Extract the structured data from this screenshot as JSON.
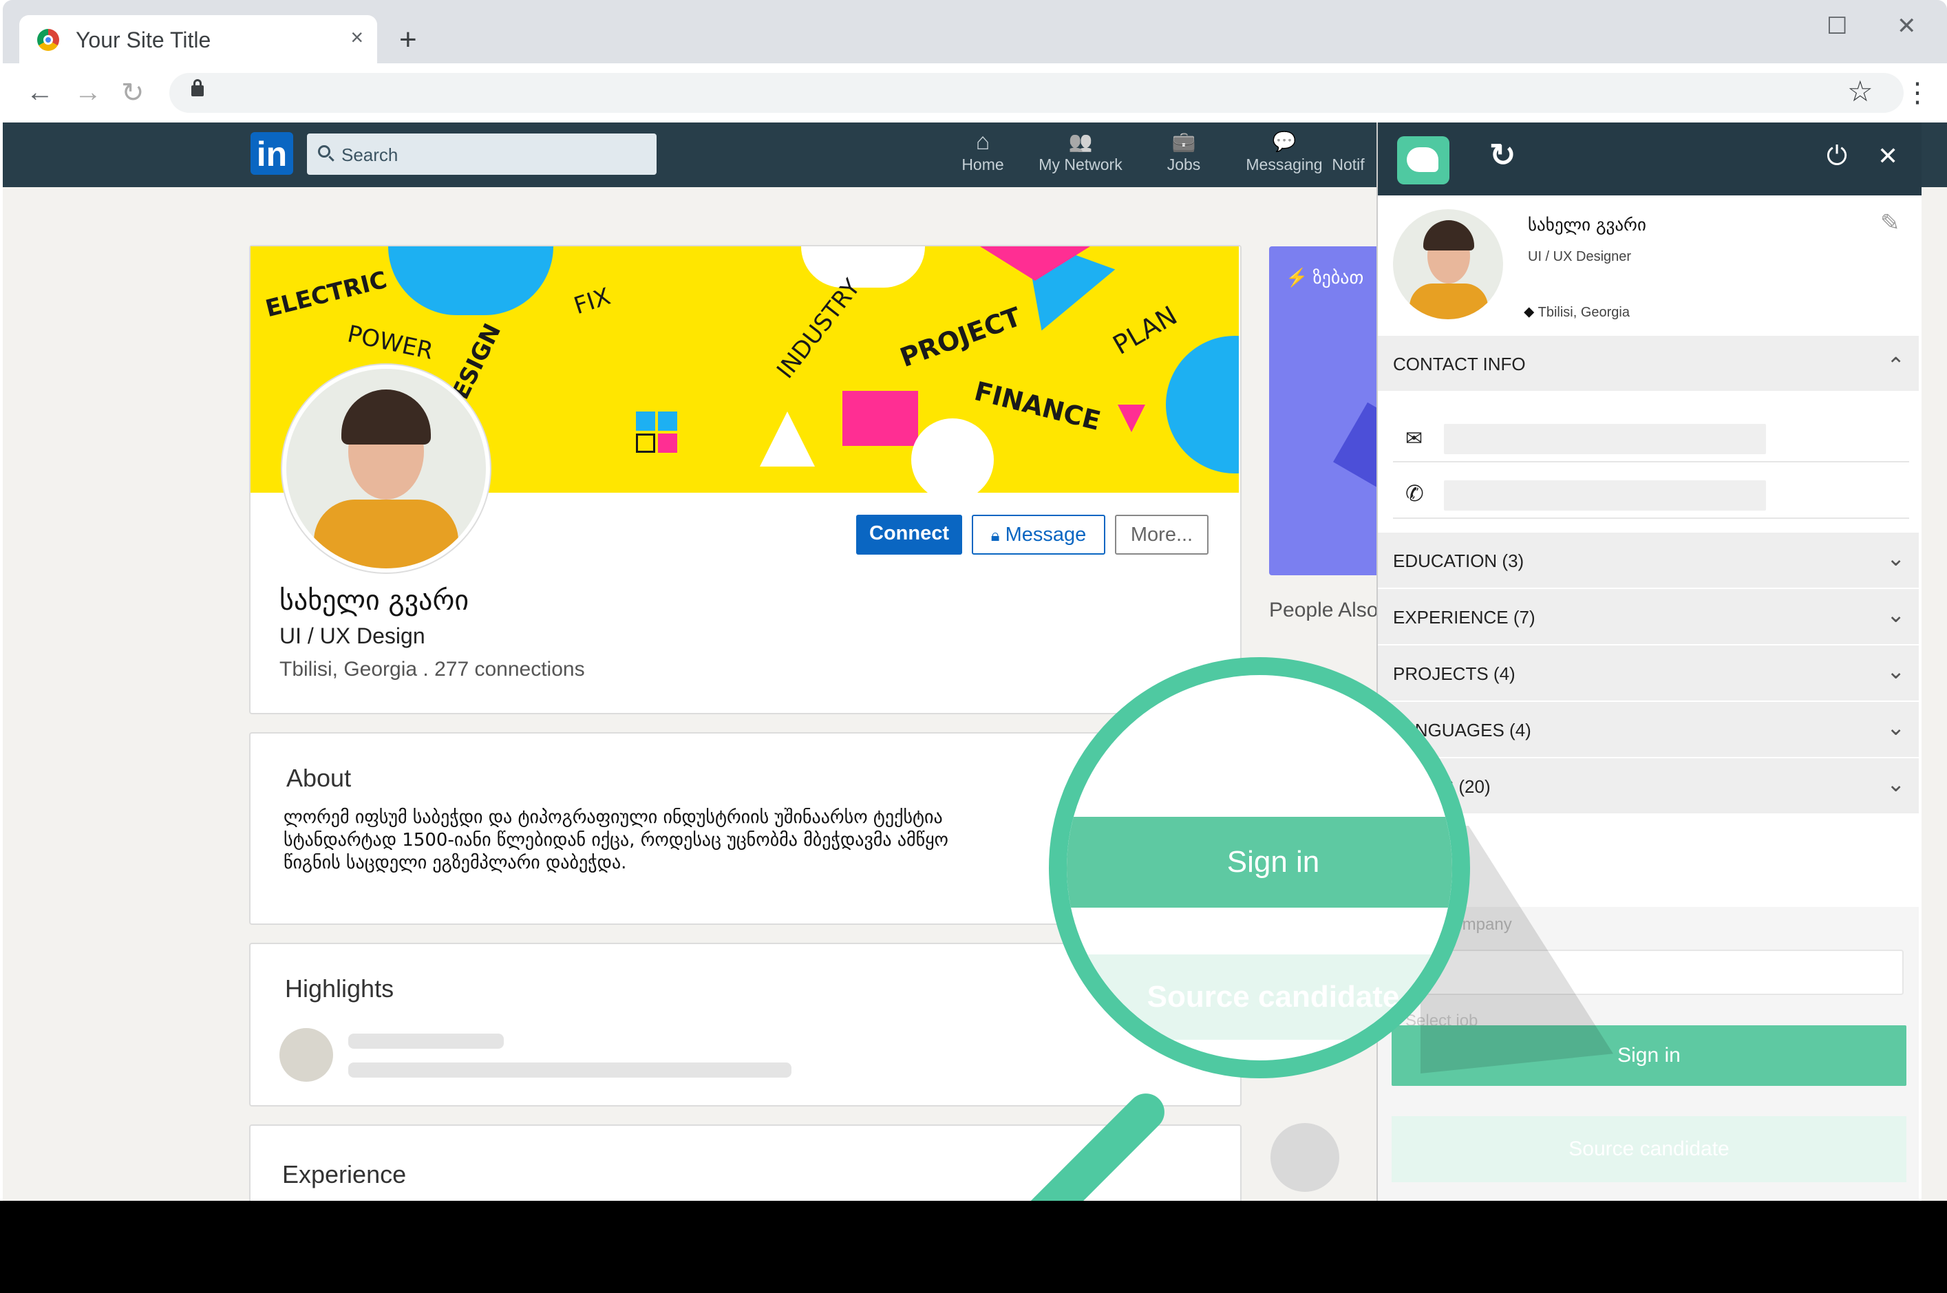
{
  "browser": {
    "tab_title": "Your Site Title",
    "tab_close": "×",
    "new_tab": "+",
    "minimize": "—",
    "maximize": "☐",
    "close": "✕",
    "back": "←",
    "forward": "→",
    "reload": "↻",
    "bookmark": "☆",
    "menu": "⋮"
  },
  "linkedin": {
    "logo": "in",
    "search_placeholder": "Search",
    "nav": [
      {
        "label": "Home",
        "icon": "⌂"
      },
      {
        "label": "My Network",
        "icon": "👥"
      },
      {
        "label": "Jobs",
        "icon": "💼"
      },
      {
        "label": "Messaging",
        "icon": "💬"
      },
      {
        "label": "Notif",
        "icon": ""
      }
    ],
    "banner_words": [
      "ELECTRIC",
      "POWER",
      "DESIGN",
      "FIX",
      "INDUSTRY",
      "PROJECT",
      "FINANCE",
      "PLAN"
    ],
    "profile": {
      "name": "სახელი გვარი",
      "headline": "UI / UX Design",
      "location": "Tbilisi, Georgia . 277 connections"
    },
    "buttons": {
      "connect": "Connect",
      "message": "Message",
      "more": "More..."
    },
    "about_title": "About",
    "about_lines": [
      "ლორემ იფსუმ საბეჭდი და ტიპოგრაფიული ინდუსტრიის უშინაარსო ტექსტია",
      "სტანდარტად 1500-იანი წლებიდან იქცა, როდესაც უცნობმა მბეჭდავმა ამწყო",
      "წიგნის საცდელი ეგზემპლარი დაბეჭდა."
    ],
    "highlights_title": "Highlights",
    "experience_title": "Experience",
    "people_also": "People Also",
    "ad_text": "ზებათ"
  },
  "extension": {
    "logo_icon": "dog-icon",
    "refresh": "↻",
    "power": "⏻",
    "close": "✕",
    "edit": "✎",
    "name": "სახელი გვარი",
    "title": "UI / UX Designer",
    "location": "Tbilisi, Georgia",
    "location_pin": "⬥",
    "contact_info": "CONTACT INFO",
    "collapse": "⌃",
    "email_icon": "✉",
    "phone_icon": "✆",
    "sections": [
      {
        "label": "EDUCATION (3)"
      },
      {
        "label": "EXPERIENCE (7)"
      },
      {
        "label": "PROJECTS (4)"
      },
      {
        "label": "LANGUAGES (4)"
      },
      {
        "label": "SKILLS (20)"
      }
    ],
    "company_placeholder": "Company",
    "select_job": "Select job",
    "sign_in": "Sign in",
    "source_candidate": "Source candidate",
    "chevron": "⌄"
  },
  "magnifier": {
    "sign_in": "Sign in",
    "source_candidate": "Source candidate"
  },
  "colors": {
    "linkedin_blue": "#0a66c2",
    "linkedin_bar": "#283e4a",
    "extension_head": "#253a46",
    "brand_green": "#4fc9a1",
    "banner_yellow": "#ffe600"
  }
}
